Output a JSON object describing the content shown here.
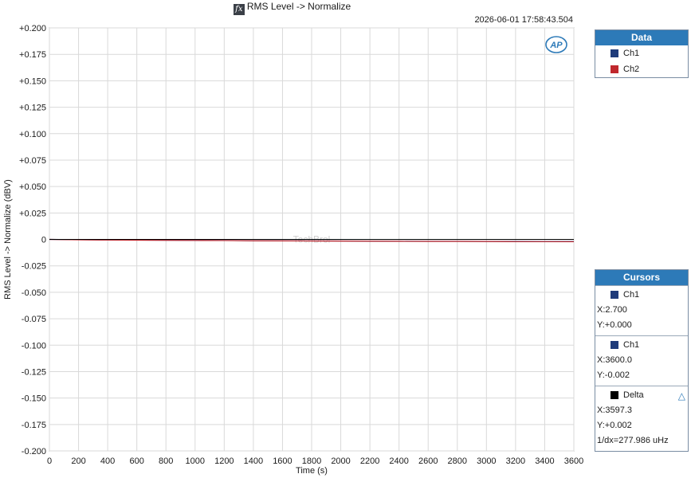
{
  "header": {
    "fx_glyph": "fx",
    "title": "RMS Level -> Normalize",
    "timestamp": "2026-06-01 17:58:43.504"
  },
  "logo": {
    "text": "AP"
  },
  "watermark": "TechBrol",
  "chart_data": {
    "type": "line",
    "xlabel": "Time (s)",
    "ylabel": "RMS Level -> Normalize (dBV)",
    "xlim": [
      0,
      3600
    ],
    "ylim": [
      -0.2,
      0.2
    ],
    "x_ticks": [
      0,
      200,
      400,
      600,
      800,
      1000,
      1200,
      1400,
      1600,
      1800,
      2000,
      2200,
      2400,
      2600,
      2800,
      3000,
      3200,
      3400,
      3600
    ],
    "x_tick_labels": [
      "0",
      "200",
      "400",
      "600",
      "800",
      "1000",
      "1200",
      "1400",
      "1600",
      "1800",
      "2000",
      "2200",
      "2400",
      "2600",
      "2800",
      "3000",
      "3200",
      "3400",
      "3600"
    ],
    "y_ticks": [
      0.2,
      0.175,
      0.15,
      0.125,
      0.1,
      0.075,
      0.05,
      0.025,
      0,
      -0.025,
      -0.05,
      -0.075,
      -0.1,
      -0.125,
      -0.15,
      -0.175,
      -0.2
    ],
    "y_tick_labels": [
      "+0.200",
      "+0.175",
      "+0.150",
      "+0.125",
      "+0.100",
      "+0.075",
      "+0.050",
      "+0.025",
      "0",
      "-0.025",
      "-0.050",
      "-0.075",
      "-0.100",
      "-0.125",
      "-0.150",
      "-0.175",
      "-0.200"
    ],
    "grid": true,
    "legend": "right",
    "series": [
      {
        "name": "Ch1",
        "color": "#1f3b7a",
        "x": [
          0,
          200,
          400,
          600,
          800,
          1000,
          1200,
          1400,
          1600,
          1800,
          2000,
          2200,
          2400,
          2600,
          2800,
          3000,
          3200,
          3400,
          3600
        ],
        "y": [
          0.0,
          -0.0003,
          -0.0005,
          -0.0007,
          -0.0008,
          -0.0009,
          -0.001,
          -0.0012,
          -0.0013,
          -0.0014,
          -0.0015,
          -0.0016,
          -0.0017,
          -0.0018,
          -0.0018,
          -0.0019,
          -0.0019,
          -0.002,
          -0.002
        ]
      },
      {
        "name": "Ch2",
        "color": "#c0282d",
        "x": [
          0,
          200,
          400,
          600,
          800,
          1000,
          1200,
          1400,
          1600,
          1800,
          2000,
          2200,
          2400,
          2600,
          2800,
          3000,
          3200,
          3400,
          3600
        ],
        "y": [
          0.0,
          -0.0004,
          -0.0006,
          -0.0008,
          -0.0009,
          -0.001,
          -0.0011,
          -0.0013,
          -0.0014,
          -0.0015,
          -0.0016,
          -0.0017,
          -0.0018,
          -0.0019,
          -0.0019,
          -0.002,
          -0.0021,
          -0.0021,
          -0.0022
        ]
      }
    ],
    "reference_line": {
      "y": 0,
      "color": "#000000"
    }
  },
  "data_panel": {
    "title": "Data",
    "items": [
      {
        "label": "Ch1",
        "color": "#1f3b7a"
      },
      {
        "label": "Ch2",
        "color": "#c0282d"
      }
    ]
  },
  "cursors_panel": {
    "title": "Cursors",
    "cursor1": {
      "label": "Ch1",
      "color": "#1f3b7a",
      "x": "X:2.700",
      "y": "Y:+0.000"
    },
    "cursor2": {
      "label": "Ch1",
      "color": "#1f3b7a",
      "x": "X:3600.0",
      "y": "Y:-0.002"
    },
    "delta": {
      "label": "Delta",
      "color": "#000000",
      "icon": "delta-triangle-icon",
      "x": "X:3597.3",
      "y": "Y:+0.002",
      "freq": "1/dx=277.986 uHz"
    }
  }
}
